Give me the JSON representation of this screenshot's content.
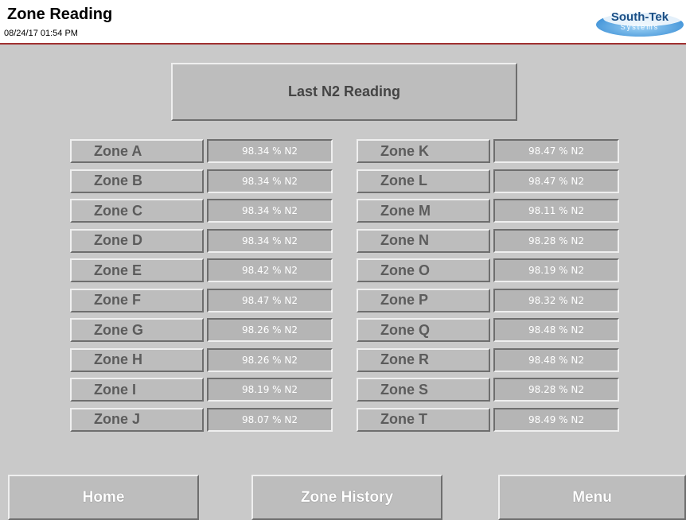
{
  "header": {
    "title": "Zone Reading",
    "datetime": "08/24/17  01:54 PM",
    "logo_text": "South-Tek",
    "logo_sub": "Systems"
  },
  "banner": {
    "label": "Last N2 Reading"
  },
  "zones_left": [
    {
      "name": "Zone A",
      "value": "98.34 % N2"
    },
    {
      "name": "Zone B",
      "value": "98.34 % N2"
    },
    {
      "name": "Zone C",
      "value": "98.34 % N2"
    },
    {
      "name": "Zone D",
      "value": "98.34 % N2"
    },
    {
      "name": "Zone E",
      "value": "98.42 % N2"
    },
    {
      "name": "Zone F",
      "value": "98.47 % N2"
    },
    {
      "name": "Zone G",
      "value": "98.26 % N2"
    },
    {
      "name": "Zone H",
      "value": "98.26 % N2"
    },
    {
      "name": "Zone I",
      "value": "98.19 % N2"
    },
    {
      "name": "Zone J",
      "value": "98.07 % N2"
    }
  ],
  "zones_right": [
    {
      "name": "Zone K",
      "value": "98.47 % N2"
    },
    {
      "name": "Zone L",
      "value": "98.47 % N2"
    },
    {
      "name": "Zone M",
      "value": "98.11 % N2"
    },
    {
      "name": "Zone N",
      "value": "98.28 % N2"
    },
    {
      "name": "Zone O",
      "value": "98.19 % N2"
    },
    {
      "name": "Zone P",
      "value": "98.32 % N2"
    },
    {
      "name": "Zone Q",
      "value": "98.48 % N2"
    },
    {
      "name": "Zone R",
      "value": "98.48 % N2"
    },
    {
      "name": "Zone S",
      "value": "98.28 % N2"
    },
    {
      "name": "Zone T",
      "value": "98.49 % N2"
    }
  ],
  "nav": {
    "home": "Home",
    "history": "Zone History",
    "menu": "Menu"
  },
  "colors": {
    "background": "#c9c9c9",
    "header_border": "#a03030",
    "logo_blue": "#1a4f86"
  }
}
